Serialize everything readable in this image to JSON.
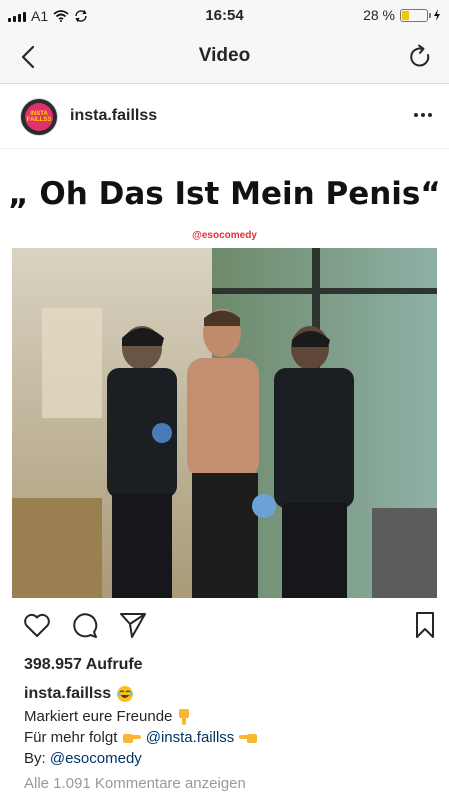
{
  "status_bar": {
    "carrier": "A1",
    "time": "16:54",
    "battery_percent": "28 %",
    "battery_level": 0.28
  },
  "nav": {
    "title": "Video"
  },
  "post": {
    "username": "insta.faillss",
    "avatar_text": "INSTA FAILLSS"
  },
  "media": {
    "title": "„ Oh Das Ist Mein Penis“",
    "handle": "@esocomedy"
  },
  "views": "398.957 Aufrufe",
  "caption": {
    "username": "insta.faillss",
    "line1": "Markiert eure Freunde",
    "line2_prefix": "Für mehr folgt",
    "line2_link": "@insta.faillss",
    "line3_prefix": "By:",
    "line3_link": "@esocomedy"
  },
  "comments_link": "Alle 1.091 Kommentare anzeigen",
  "colors": {
    "link": "#003569",
    "muted": "#999999",
    "battery": "#f5c400",
    "handle": "#e0313b"
  }
}
